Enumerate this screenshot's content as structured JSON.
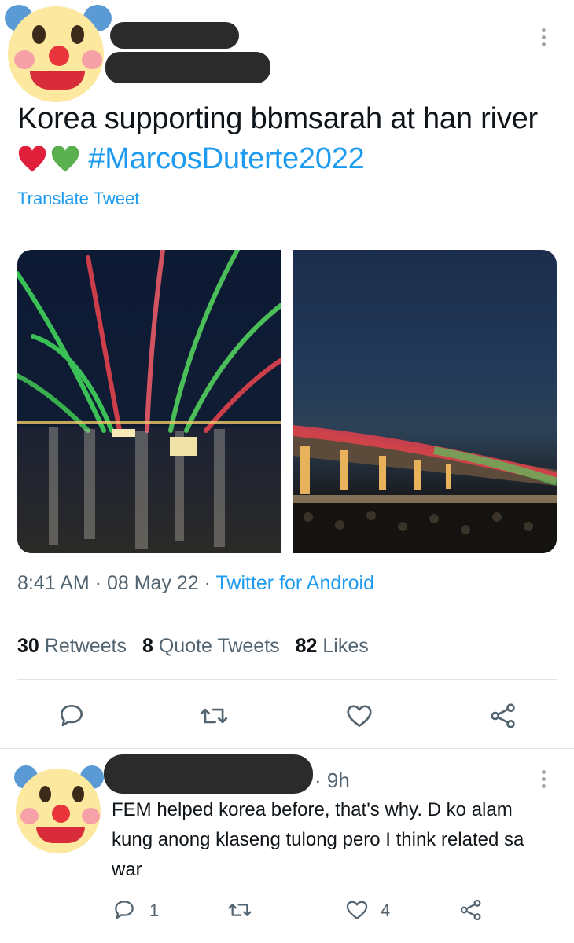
{
  "tweet": {
    "text_main": "Korea supporting bbmsarah at han river ",
    "hearts": [
      "red-heart",
      "green-heart"
    ],
    "hashtag": "#MarcosDuterte2022",
    "translate_label": "Translate Tweet",
    "time": "8:41 AM",
    "date": "08 May 22",
    "source": "Twitter for Android",
    "separator": "·"
  },
  "stats": {
    "retweets_count": "30",
    "retweets_label": "Retweets",
    "quotes_count": "8",
    "quotes_label": "Quote Tweets",
    "likes_count": "82",
    "likes_label": "Likes"
  },
  "reply": {
    "time": "· 9h",
    "text": "FEM helped korea before, that's why. D ko alam kung anong klaseng tulong pero I think related sa war",
    "reply_count": "1",
    "like_count": "4"
  },
  "colors": {
    "accent": "#1d9bf0",
    "muted": "#536471",
    "heart_red": "#e0203b",
    "heart_green": "#5aaf4f"
  },
  "icons": {
    "actions": [
      "reply-icon",
      "retweet-icon",
      "like-icon",
      "share-icon"
    ],
    "overflow": "more-options-icon",
    "avatar": "clown-face-emoji"
  }
}
